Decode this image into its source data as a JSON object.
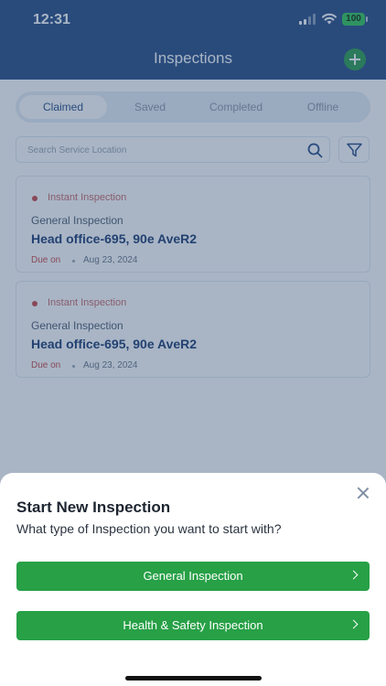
{
  "status_bar": {
    "time": "12:31",
    "battery": "100"
  },
  "nav": {
    "title": "Inspections"
  },
  "tabs": [
    {
      "label": "Claimed"
    },
    {
      "label": "Saved"
    },
    {
      "label": "Completed"
    },
    {
      "label": "Offline"
    }
  ],
  "search": {
    "placeholder": "Search Service Location"
  },
  "cards": [
    {
      "badge": "Instant Inspection",
      "type": "General Inspection",
      "location": "Head office-695, 90e AveR2",
      "due_label": "Due on",
      "due_date": "Aug 23, 2024"
    },
    {
      "badge": "Instant Inspection",
      "type": "General Inspection",
      "location": "Head office-695, 90e AveR2",
      "due_label": "Due on",
      "due_date": "Aug 23, 2024"
    }
  ],
  "sheet": {
    "title": "Start New Inspection",
    "subtitle": "What type of Inspection you want to start with?",
    "buttons": [
      {
        "label": "General Inspection"
      },
      {
        "label": "Health & Safety Inspection"
      }
    ]
  },
  "colors": {
    "header": "#2a4f86",
    "accent_green": "#27a046",
    "badge_red": "#c94a4a"
  }
}
